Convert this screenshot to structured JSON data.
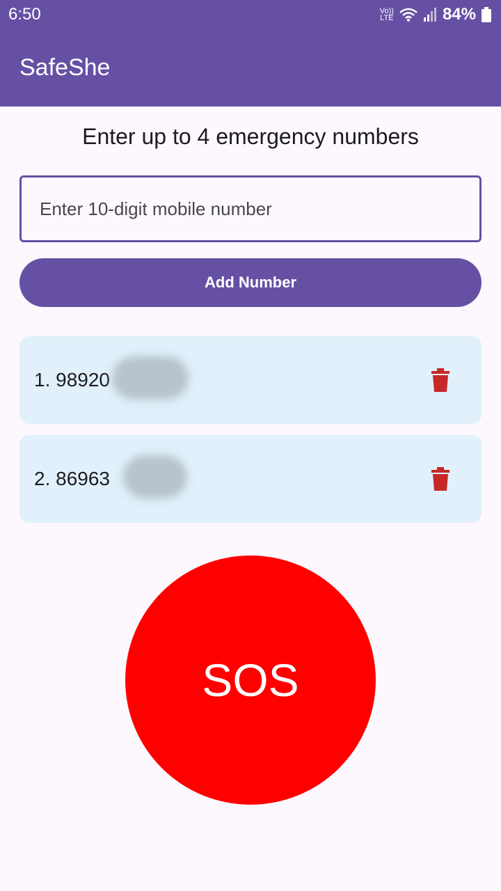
{
  "status_bar": {
    "time": "6:50",
    "volte_top": "Vo))",
    "volte_bottom": "LTE",
    "battery": "84%"
  },
  "app_bar": {
    "title": "SafeShe"
  },
  "main": {
    "heading": "Enter up to 4 emergency numbers",
    "input_placeholder": "Enter 10-digit mobile number",
    "add_button_label": "Add Number",
    "numbers": [
      {
        "label": "1. 98920"
      },
      {
        "label": "2. 86963"
      }
    ],
    "sos_label": "SOS"
  },
  "colors": {
    "primary": "#6650a4",
    "card": "#e1f0fb",
    "delete": "#c62828",
    "sos": "#ff0000",
    "background": "#fdf8fd"
  }
}
